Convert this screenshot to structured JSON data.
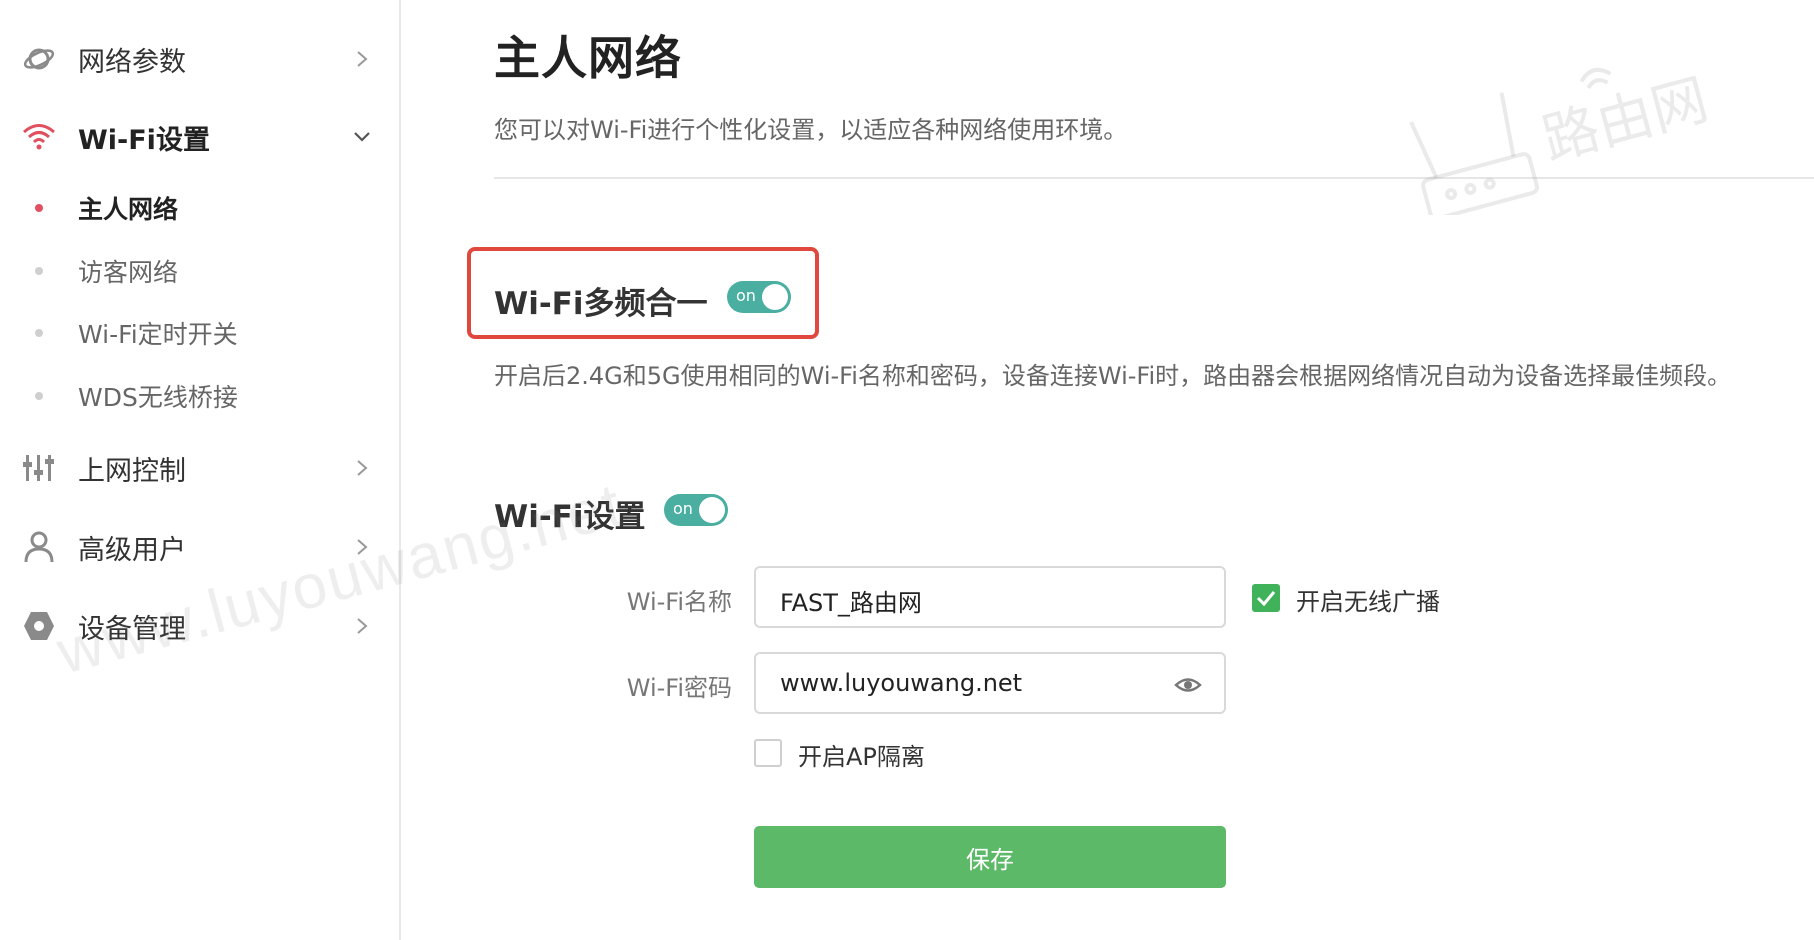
{
  "sidebar": {
    "groups": [
      {
        "label": "网络参数",
        "icon": "planet-icon"
      },
      {
        "label": "Wi-Fi设置",
        "icon": "wifi-icon",
        "expanded": true
      },
      {
        "label": "上网控制",
        "icon": "sliders-icon"
      },
      {
        "label": "高级用户",
        "icon": "user-icon"
      },
      {
        "label": "设备管理",
        "icon": "hexagon-icon"
      }
    ],
    "sub_items": [
      {
        "label": "主人网络",
        "active": true
      },
      {
        "label": "访客网络"
      },
      {
        "label": "Wi-Fi定时开关"
      },
      {
        "label": "WDS无线桥接"
      }
    ]
  },
  "main": {
    "title": "主人网络",
    "description": "您可以对Wi-Fi进行个性化设置，以适应各种网络使用环境。",
    "multiband": {
      "title": "Wi-Fi多频合一",
      "toggle_text": "on",
      "enabled": true,
      "note": "开启后2.4G和5G使用相同的Wi-Fi名称和密码，设备连接Wi-Fi时，路由器会根据网络情况自动为设备选择最佳频段。"
    },
    "wifi_settings": {
      "title": "Wi-Fi设置",
      "toggle_text": "on",
      "enabled": true,
      "name_label": "Wi-Fi名称",
      "name_value": "FAST_路由网",
      "broadcast_label": "开启无线广播",
      "broadcast_checked": true,
      "password_label": "Wi-Fi密码",
      "password_value": "www.luyouwang.net",
      "ap_isolation_label": "开启AP隔离",
      "ap_isolation_checked": false,
      "save_label": "保存"
    }
  },
  "watermark": {
    "text": "www.luyouwang.net",
    "logo_text": "路由网"
  },
  "colors": {
    "accent_red": "#e0505f",
    "toggle_teal": "#4aaea0",
    "save_green": "#5cb968",
    "check_green": "#3fb25a",
    "highlight_red": "#e0483e"
  }
}
